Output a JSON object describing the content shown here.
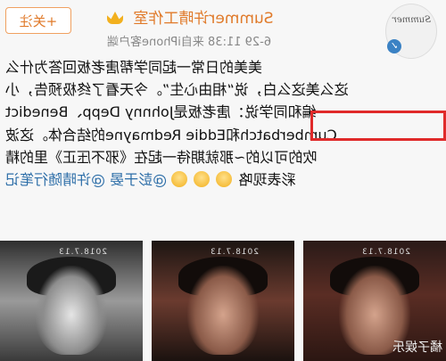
{
  "header": {
    "follow_label": "+关注",
    "account_name": "Summer许晴工作室",
    "timestamp": "6-29 11:38",
    "source": "来自iPhone客户端",
    "avatar_text": "Summer"
  },
  "post": {
    "lines": [
      "美美的日常一起同学帮唐老板回答为什么",
      "这么美这么白，说“相由心生”。今天看了终极预告，小",
      "编和同学说：唐老板是Johnny Depp、Benedict",
      "Cumberbatch和Eddie Redmayne的结合体。这波",
      "吹的可以的~那就期待一起在《邪不压正》里的精",
      "彩表现咯",
      ""
    ],
    "emoji_count": 3,
    "mentions": [
      "@彭于晏",
      "@许晴随行笔记"
    ]
  },
  "photos": [
    {
      "date": "2018.7.13",
      "watermark": "橘子娱乐"
    },
    {
      "date": "2018.7.13",
      "watermark": ""
    },
    {
      "date": "2018.7.13",
      "watermark": ""
    }
  ],
  "colors": {
    "accent": "#e07a2a",
    "link": "#2d6ea8",
    "highlight": "#e02a2a"
  }
}
